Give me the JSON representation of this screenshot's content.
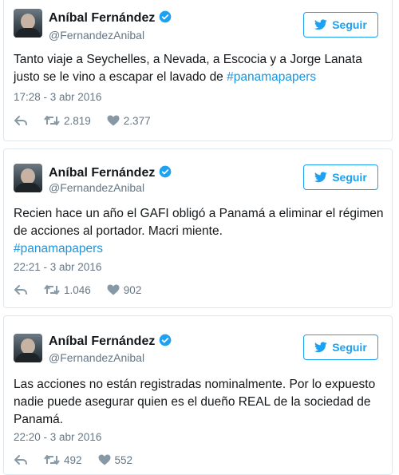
{
  "tweets": [
    {
      "name": "Aníbal Fernández",
      "handle": "@FernandezAnibal",
      "follow_label": "Seguir",
      "text": "Tanto viaje a Seychelles, a Nevada, a Escocia y a Jorge Lanata justo se le vino a escapar el lavado de",
      "hashtag": "#panamapapers",
      "timestamp": "17:28 - 3 abr 2016",
      "retweets": "2.819",
      "likes": "2.377"
    },
    {
      "name": "Aníbal Fernández",
      "handle": "@FernandezAnibal",
      "follow_label": "Seguir",
      "text": "Recien hace un año el GAFI obligó a Panamá a eliminar el régimen de acciones al portador. Macri miente.",
      "hashtag": "#panamapapers",
      "timestamp": "22:21 - 3 abr 2016",
      "retweets": "1.046",
      "likes": "902"
    },
    {
      "name": "Aníbal Fernández",
      "handle": "@FernandezAnibal",
      "follow_label": "Seguir",
      "text": "Las acciones no están registradas nominalmente. Por lo expuesto nadie puede asegurar quien es el dueño REAL de la sociedad de Panamá.",
      "hashtag": "",
      "timestamp": "22:20 - 3 abr 2016",
      "retweets": "492",
      "likes": "552"
    }
  ],
  "colors": {
    "accent": "#1da1f2",
    "hashtag": "#1b95e0",
    "muted": "#657786",
    "border": "#e1e8ed"
  },
  "icons": [
    "verified-badge-icon",
    "twitter-bird-icon",
    "reply-icon",
    "retweet-icon",
    "heart-icon"
  ]
}
